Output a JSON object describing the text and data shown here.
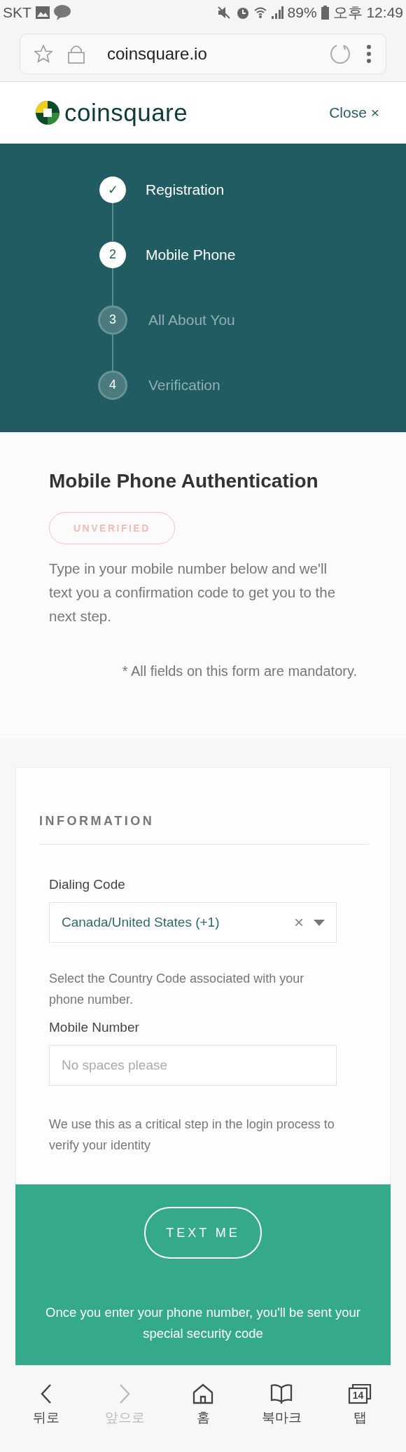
{
  "status_bar": {
    "carrier": "SKT",
    "battery": "89%",
    "time": "오후 12:49"
  },
  "browser": {
    "url": "coinsquare.io"
  },
  "header": {
    "logo_text": "coinsquare",
    "close": "Close ×"
  },
  "steps": [
    {
      "number": "✓",
      "label": "Registration",
      "kind": "done"
    },
    {
      "number": "2",
      "label": "Mobile Phone",
      "kind": "current"
    },
    {
      "number": "3",
      "label": "All About You",
      "kind": "pending"
    },
    {
      "number": "4",
      "label": "Verification",
      "kind": "pending"
    }
  ],
  "intro": {
    "title": "Mobile Phone Authentication",
    "badge": "UNVERIFIED",
    "text": "Type in your mobile number below and we'll text you a confirmation code to get you to the next step.",
    "note": "* All fields on this form are mandatory."
  },
  "form": {
    "section": "INFORMATION",
    "dialing_label": "Dialing Code",
    "dialing_value": "Canada/United States (+1)",
    "clear": "×",
    "dialing_help": "Select the Country Code associated with your phone number.",
    "mobile_label": "Mobile Number",
    "mobile_placeholder": "No spaces please",
    "mobile_help": "We use this as a critical step in the login process to verify your identity"
  },
  "action": {
    "button": "TEXT ME",
    "text": "Once you enter your phone number, you'll be sent your special security code"
  },
  "nav": [
    {
      "kind": "back",
      "label": "뒤로",
      "disabled": false
    },
    {
      "kind": "forward",
      "label": "앞으로",
      "disabled": true
    },
    {
      "kind": "home",
      "label": "홈",
      "disabled": false
    },
    {
      "kind": "bookmarks",
      "label": "북마크",
      "disabled": false
    },
    {
      "kind": "tabs",
      "label": "탭",
      "disabled": false,
      "count": "14"
    }
  ]
}
